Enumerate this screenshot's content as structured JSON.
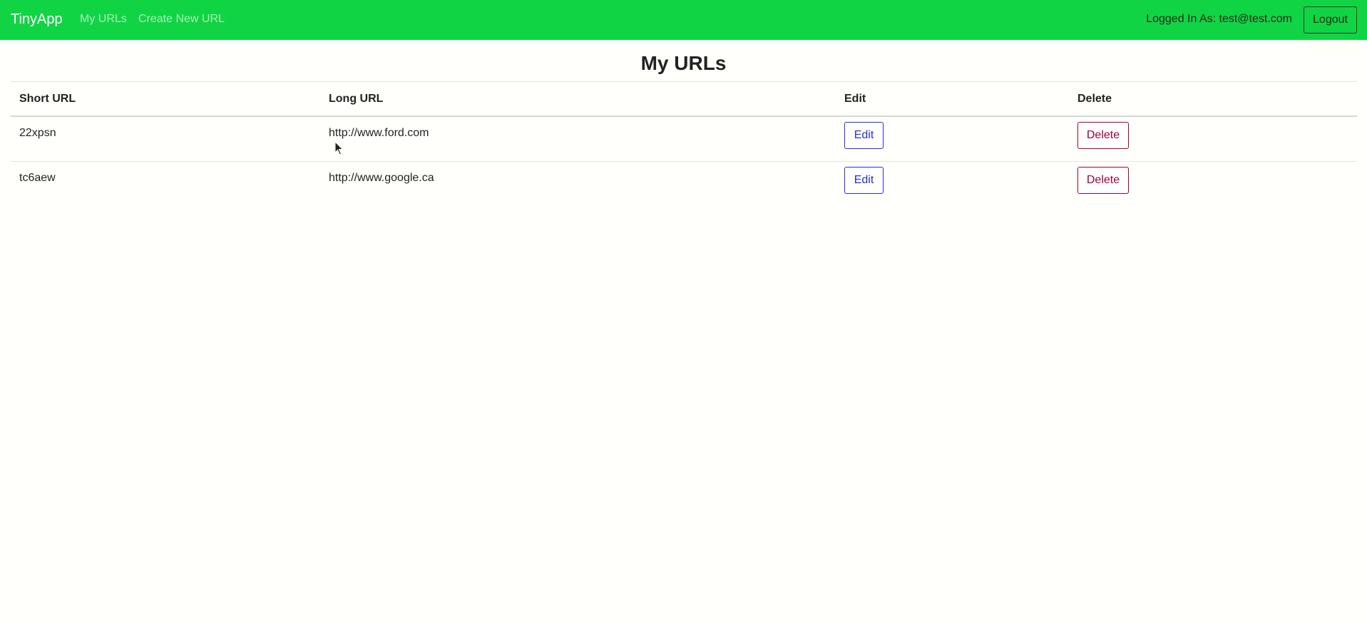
{
  "navbar": {
    "brand": "TinyApp",
    "links": {
      "my_urls": "My URLs",
      "create_new": "Create New URL"
    },
    "user_label": "Logged In As: test@test.com",
    "logout_label": "Logout",
    "background_color": "#11d444"
  },
  "main": {
    "title": "My URLs",
    "table": {
      "headers": {
        "short_url": "Short URL",
        "long_url": "Long URL",
        "edit": "Edit",
        "delete": "Delete"
      },
      "rows": [
        {
          "short_url": "22xpsn",
          "long_url": "http://www.ford.com",
          "edit_label": "Edit",
          "delete_label": "Delete"
        },
        {
          "short_url": "tc6aew",
          "long_url": "http://www.google.ca",
          "edit_label": "Edit",
          "delete_label": "Delete"
        }
      ]
    }
  },
  "colors": {
    "edit_accent": "#2233cc",
    "delete_accent": "#a00038"
  },
  "icons": {
    "cursor": "mouse-pointer-icon"
  }
}
